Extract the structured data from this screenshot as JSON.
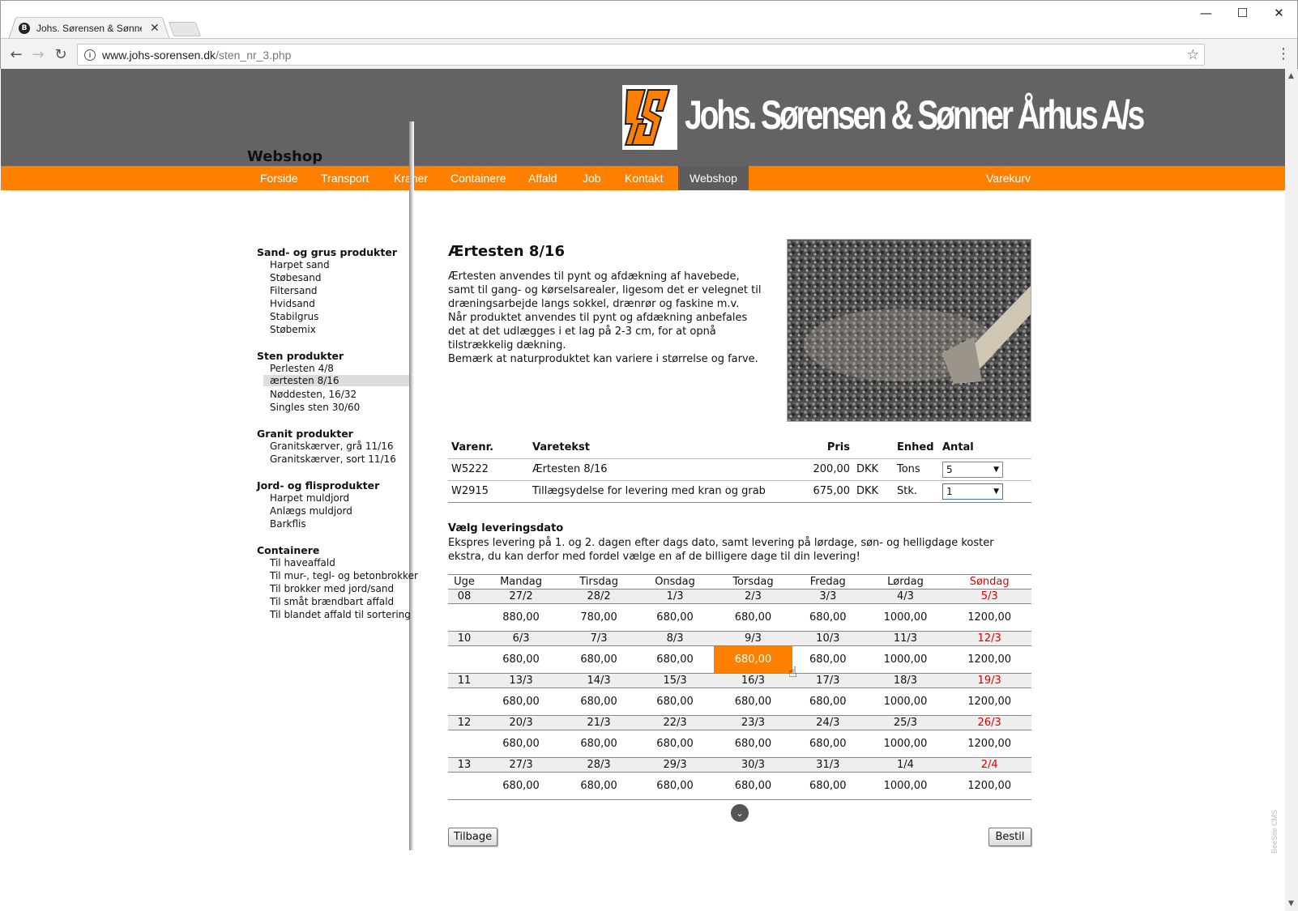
{
  "browser": {
    "tab_title": "Johs. Sørensen & Sønner",
    "tab_favicon": "B",
    "url_host": "www.johs-sorensen.dk",
    "url_path": "/sten_nr_3.php"
  },
  "site": {
    "logo_text": "Johs. Sørensen & Sønner Århus A/s",
    "nav": [
      "Forside",
      "Transport",
      "Kraner",
      "Containere",
      "Affald",
      "Job",
      "Kontakt",
      "Webshop"
    ],
    "nav_active": "Webshop",
    "cart_label": "Varekurv"
  },
  "sidebar": {
    "title": "Webshop",
    "categories": [
      {
        "name": "Sand- og grus produkter",
        "items": [
          "Harpet sand",
          "Støbesand",
          "Filtersand",
          "Hvidsand",
          "Stabilgrus",
          "Støbemix"
        ]
      },
      {
        "name": "Sten produkter",
        "items": [
          "Perlesten 4/8",
          "ærtesten 8/16",
          "Nøddesten, 16/32",
          "Singles sten 30/60"
        ]
      },
      {
        "name": "Granit produkter",
        "items": [
          "Granitskærver, grå 11/16",
          "Granitskærver, sort 11/16"
        ]
      },
      {
        "name": "Jord- og flisprodukter",
        "items": [
          "Harpet muldjord",
          "Anlægs muldjord",
          "Barkflis"
        ]
      },
      {
        "name": "Containere",
        "items": [
          "Til haveaffald",
          "Til mur-, tegl- og betonbrokker",
          "Til brokker med jord/sand",
          "Til småt brændbart affald",
          "Til blandet affald til sortering"
        ]
      }
    ],
    "selected_item": "ærtesten 8/16"
  },
  "product": {
    "title": "Ærtesten 8/16",
    "description": [
      "Ærtesten anvendes til pynt og afdækning af havebede, samt til gang- og kørselsarealer, ligesom det er velegnet til dræningsarbejde langs sokkel, drænrør og faskine m.v.",
      "Når produktet anvendes til pynt og afdækning anbefales det at det udlægges i et lag på 2-3 cm, for at opnå tilstrækkelig dækning.",
      "Bemærk at naturproduktet kan variere i størrelse og farve."
    ]
  },
  "items_table": {
    "headers": {
      "varenr": "Varenr.",
      "varetekst": "Varetekst",
      "pris": "Pris",
      "enhed": "Enhed",
      "antal": "Antal"
    },
    "rows": [
      {
        "varenr": "W5222",
        "varetekst": "Ærtesten 8/16",
        "pris": "200,00",
        "currency": "DKK",
        "enhed": "Tons",
        "antal": "5"
      },
      {
        "varenr": "W2915",
        "varetekst": "Tillægsydelse for levering med kran og grab",
        "pris": "675,00",
        "currency": "DKK",
        "enhed": "Stk.",
        "antal": "1"
      }
    ]
  },
  "delivery": {
    "title": "Vælg leveringsdato",
    "text": "Ekspres levering på 1. og 2. dagen efter dags dato, samt levering på lørdage, søn- og helligdage koster ekstra, du kan derfor med fordel vælge en af de billigere dage til din levering!",
    "headers": [
      "Uge",
      "Mandag",
      "Tirsdag",
      "Onsdag",
      "Torsdag",
      "Fredag",
      "Lørdag",
      "Søndag"
    ],
    "weeks": [
      {
        "week": "08",
        "dates": [
          "27/2",
          "28/2",
          "1/3",
          "2/3",
          "3/3",
          "4/3",
          "5/3"
        ],
        "prices": [
          "880,00",
          "780,00",
          "680,00",
          "680,00",
          "680,00",
          "1000,00",
          "1200,00"
        ]
      },
      {
        "week": "10",
        "dates": [
          "6/3",
          "7/3",
          "8/3",
          "9/3",
          "10/3",
          "11/3",
          "12/3"
        ],
        "prices": [
          "680,00",
          "680,00",
          "680,00",
          "680,00",
          "680,00",
          "1000,00",
          "1200,00"
        ]
      },
      {
        "week": "11",
        "dates": [
          "13/3",
          "14/3",
          "15/3",
          "16/3",
          "17/3",
          "18/3",
          "19/3"
        ],
        "prices": [
          "680,00",
          "680,00",
          "680,00",
          "680,00",
          "680,00",
          "1000,00",
          "1200,00"
        ]
      },
      {
        "week": "12",
        "dates": [
          "20/3",
          "21/3",
          "22/3",
          "23/3",
          "24/3",
          "25/3",
          "26/3"
        ],
        "prices": [
          "680,00",
          "680,00",
          "680,00",
          "680,00",
          "680,00",
          "1000,00",
          "1200,00"
        ]
      },
      {
        "week": "13",
        "dates": [
          "27/3",
          "28/3",
          "29/3",
          "30/3",
          "31/3",
          "1/4",
          "2/4"
        ],
        "prices": [
          "680,00",
          "680,00",
          "680,00",
          "680,00",
          "680,00",
          "1000,00",
          "1200,00"
        ]
      }
    ],
    "picked": {
      "week_index": 1,
      "day_index": 3
    }
  },
  "buttons": {
    "back": "Tilbage",
    "order": "Bestil"
  },
  "cms_tag": "BeeSite CMS",
  "colors": {
    "accent": "#ff8000",
    "header": "#636363",
    "sunday": "#dd0000"
  }
}
